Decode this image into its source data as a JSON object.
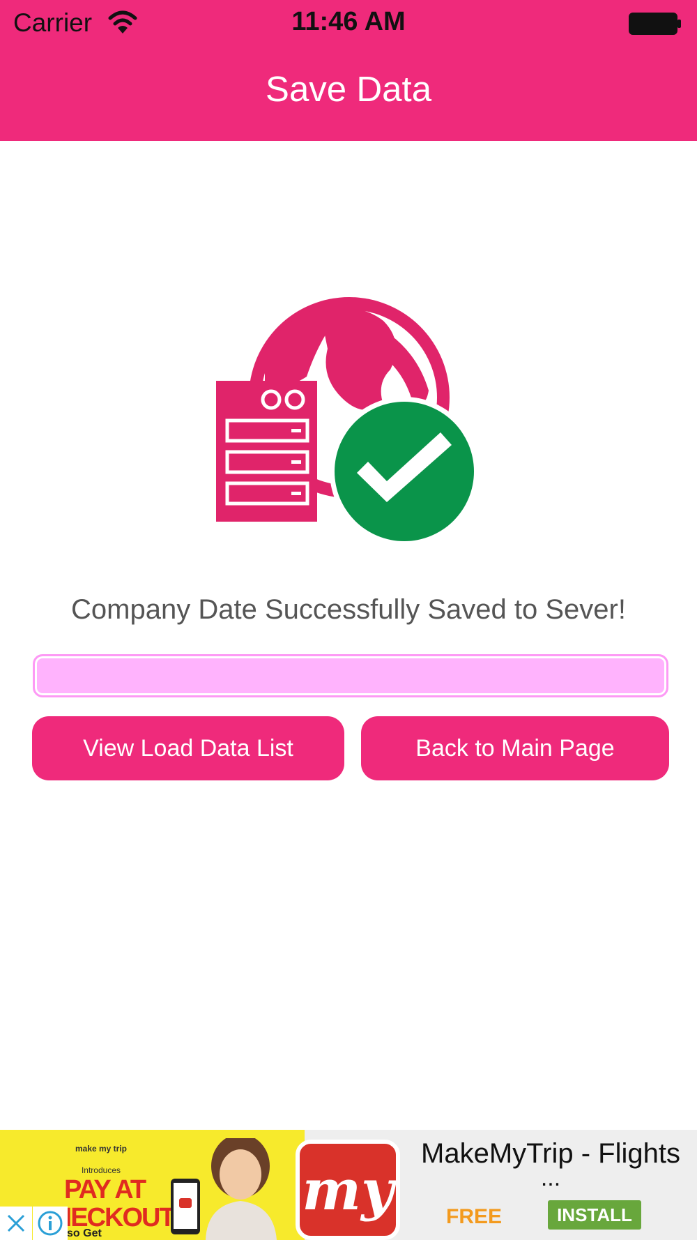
{
  "status_bar": {
    "carrier": "Carrier",
    "time": "11:46 AM"
  },
  "nav": {
    "title": "Save Data"
  },
  "main": {
    "message": "Company Date Successfully Saved to Sever!",
    "input_value": "",
    "buttons": {
      "view": "View Load Data List",
      "back": "Back to Main Page"
    }
  },
  "ad": {
    "promo_brand": "make my trip",
    "promo_intro": "Introduces",
    "promo_headline": "PAY AT CHECKOUT",
    "promo_sub": "Also Get",
    "logo_text": "my",
    "title": "MakeMyTrip - Flights",
    "ellipsis": "...",
    "price": "FREE",
    "install_label": "INSTALL"
  },
  "colors": {
    "accent": "#ef2a7b",
    "input_fill": "#ffb3fd",
    "success_green": "#0a944a",
    "ad_install": "#68a73c",
    "ad_free": "#f39a1e"
  },
  "icons": {
    "wifi": "wifi-icon",
    "battery": "battery-icon",
    "illustration": "server-globe-check-icon",
    "close": "close-icon",
    "info": "info-icon"
  }
}
